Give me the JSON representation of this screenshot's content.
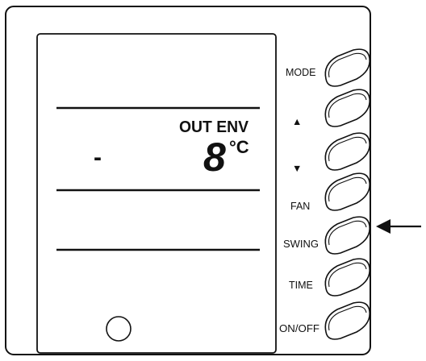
{
  "display": {
    "mode_text": "OUT ENV",
    "sign": "-",
    "temperature": "8",
    "unit": "°C"
  },
  "buttons": {
    "mode": "MODE",
    "up": "▲",
    "down": "▼",
    "fan": "FAN",
    "swing": "SWING",
    "time": "TIME",
    "onoff": "ON/OFF"
  },
  "colors": {
    "line": "#111111",
    "background": "#ffffff"
  },
  "icons": {
    "up": "triangle-up-icon",
    "down": "triangle-down-icon",
    "pointer": "arrow-left-icon"
  }
}
